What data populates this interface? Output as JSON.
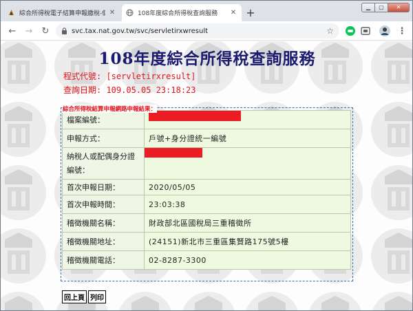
{
  "browser": {
    "tabs": [
      {
        "title": "綜合所得稅電子結算申報繳稅-個",
        "active": false
      },
      {
        "title": "108年度綜合所得稅查詢服務",
        "active": true
      }
    ],
    "new_tab": "+",
    "url": "svc.tax.nat.gov.tw/svc/servletirxwresult",
    "window_controls": {
      "minimize": "▁",
      "maximize": "▢",
      "close": "✕"
    }
  },
  "page": {
    "title": "108年度綜合所得稅查詢服務",
    "program_code": "程式代號: [servletirxresult]",
    "query_date": "查詢日期: 109.05.05 23:18:23",
    "section_label": "綜合所得稅結算申報網路申報結果：",
    "rows": [
      {
        "key": "檔案編號：",
        "value": "",
        "redacted": true
      },
      {
        "key": "申報方式：",
        "value": "戶號+身分證統一編號",
        "redacted": false
      },
      {
        "key": "納稅人或配偶身分證編號：",
        "value": "",
        "redacted": true
      },
      {
        "key": "首次申報日期：",
        "value": "2020/05/05",
        "redacted": false
      },
      {
        "key": "首次申報時間：",
        "value": "23:03:38",
        "redacted": false
      },
      {
        "key": "稽徵機關名稱：",
        "value": "財政部北區國稅局三重稽徵所",
        "redacted": false
      },
      {
        "key": "稽徵機關地址：",
        "value": "(24151)新北市三重區集賢路175號5樓",
        "redacted": false
      },
      {
        "key": "稽徵機關電話：",
        "value": "02-8287-3300",
        "redacted": false
      }
    ],
    "buttons": {
      "back": "回上頁",
      "print": "列印"
    }
  },
  "colors": {
    "accent_red": "#e0141a",
    "title_blue": "#1a1a6e",
    "redaction": "#ec1c24",
    "cell_green": "#eefae0"
  }
}
